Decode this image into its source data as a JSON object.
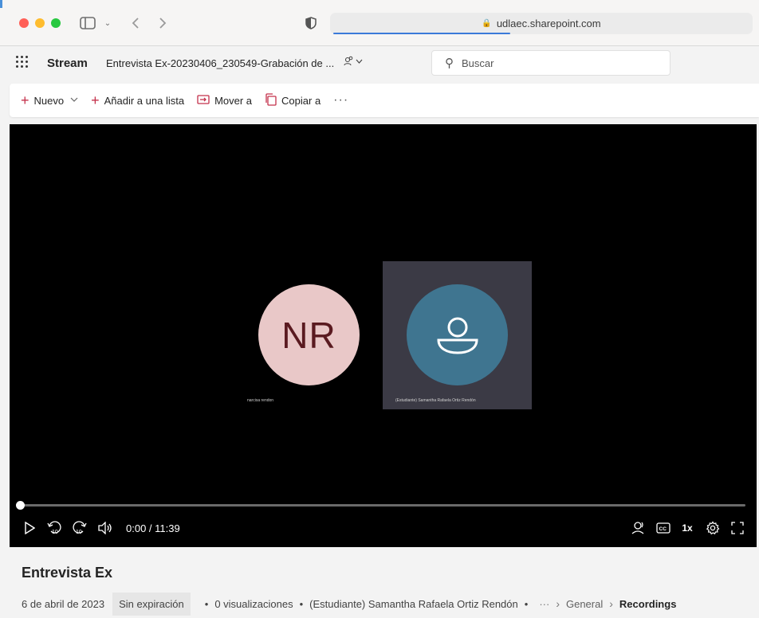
{
  "browser": {
    "url": "udlaec.sharepoint.com"
  },
  "header": {
    "app_name": "Stream",
    "document_title": "Entrevista Ex-20230406_230549-Grabación de ...",
    "search_placeholder": "Buscar"
  },
  "toolbar": {
    "new_label": "Nuevo",
    "add_to_list_label": "Añadir a una lista",
    "move_to_label": "Mover a",
    "copy_to_label": "Copiar a",
    "more_label": "···"
  },
  "video": {
    "participant1_initials": "NR",
    "participant1_name": "narcisa rendon",
    "participant2_name": "(Estudiante) Samantha Rafaela Ortiz Rendón",
    "time_display": "0:00 / 11:39",
    "progress": 0,
    "speed_label": "1x",
    "skip_back_label": "10",
    "skip_forward_label": "10"
  },
  "info": {
    "title": "Entrevista Ex",
    "date": "6 de abril de 2023",
    "expiration": "Sin expiración",
    "views": "0 visualizaciones",
    "owner": "(Estudiante) Samantha Rafaela Ortiz Rendón",
    "breadcrumb_more": "···",
    "breadcrumb_1": "General",
    "breadcrumb_2": "Recordings"
  },
  "colors": {
    "accent": "#c4314b",
    "avatar_nr_bg": "#e9c8c8",
    "avatar_person_bg": "#3f7590"
  }
}
